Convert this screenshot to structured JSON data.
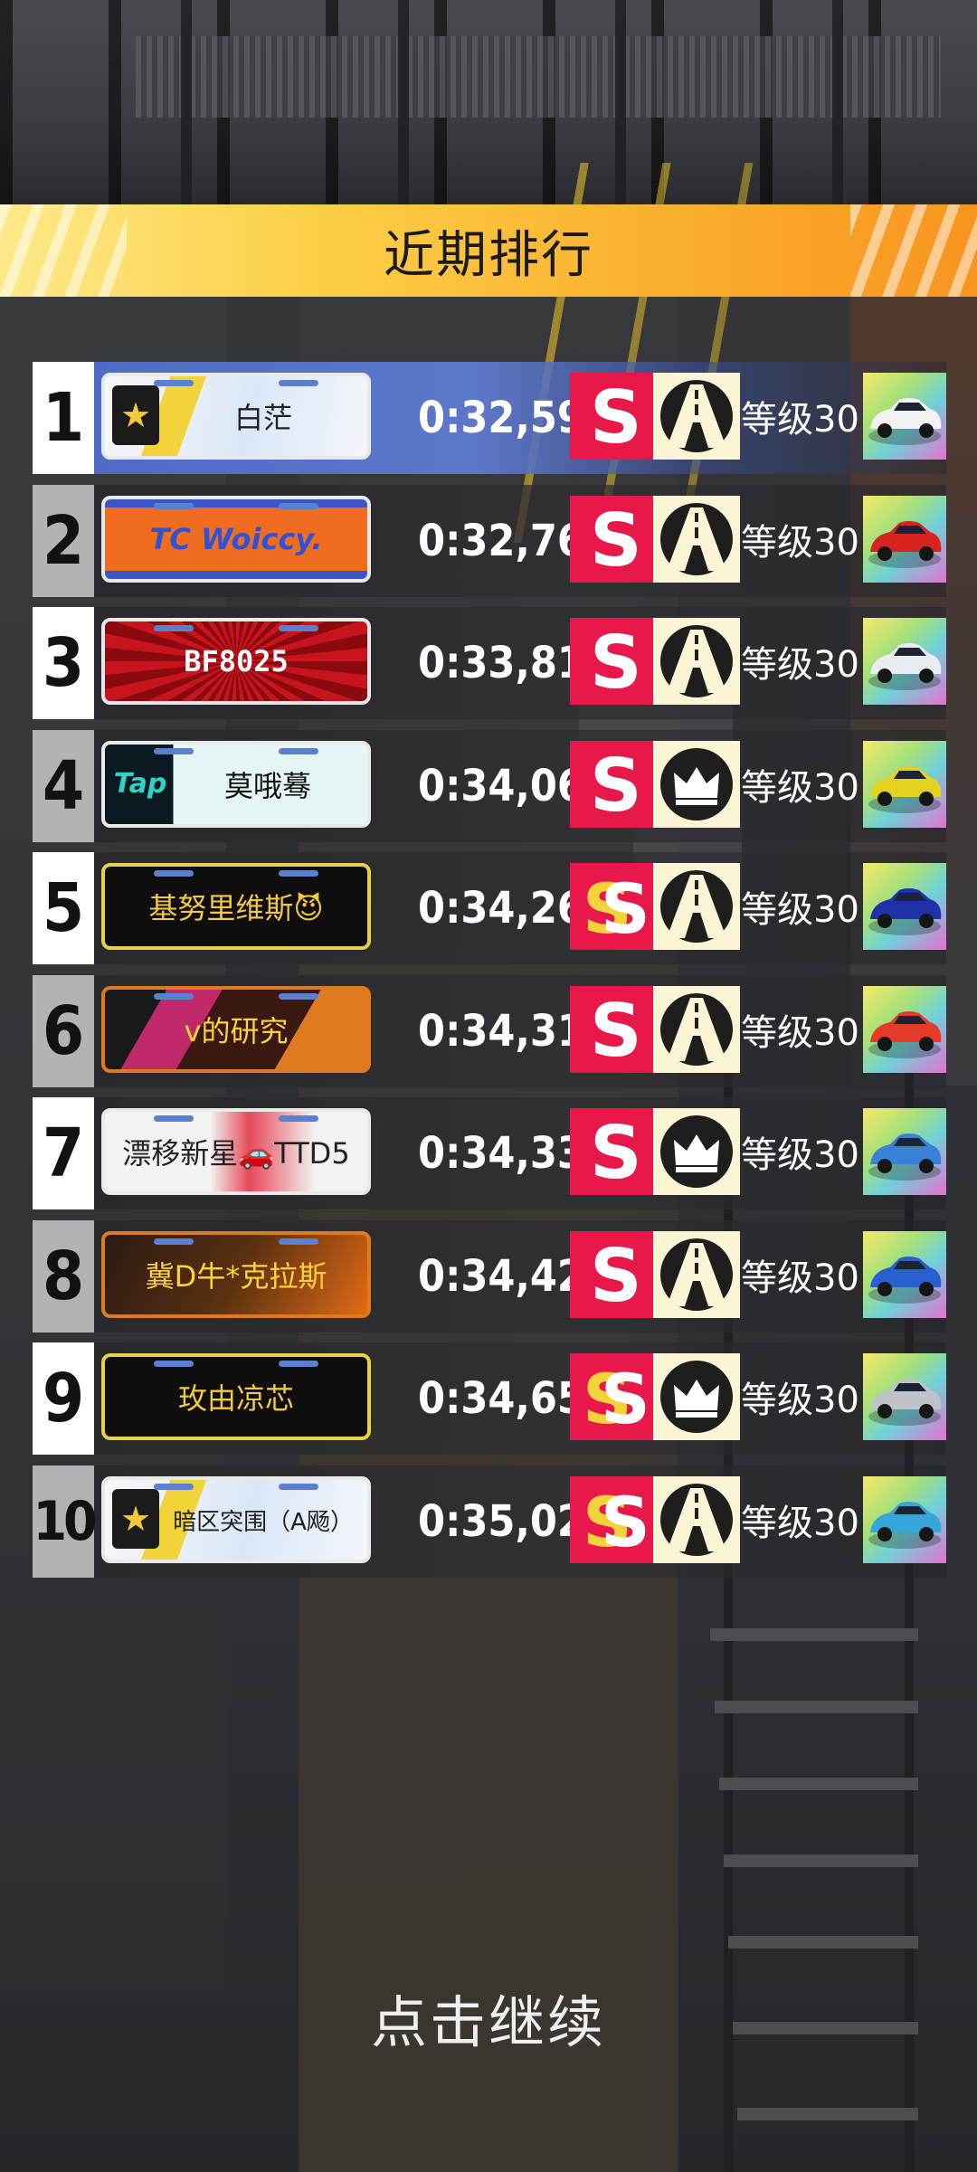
{
  "header": {
    "title": "近期排行"
  },
  "leaderboard": [
    {
      "rank": "1",
      "name": "白茫",
      "time": "0:32,59",
      "grade": "S",
      "track_icon": "road-icon",
      "level": "等级30",
      "car_color": "#f2f2f2",
      "plate_style": "white-blue"
    },
    {
      "rank": "2",
      "name": "TC Woiccy.",
      "time": "0:32,76",
      "grade": "S",
      "track_icon": "road-icon",
      "level": "等级30",
      "car_color": "#d8231f",
      "plate_style": "blue-orange"
    },
    {
      "rank": "3",
      "name": "BF8025",
      "time": "0:33,81",
      "grade": "S",
      "track_icon": "road-icon",
      "level": "等级30",
      "car_color": "#e9ecf2",
      "plate_style": "red-burst"
    },
    {
      "rank": "4",
      "name": "莫哦蓦",
      "time": "0:34,06",
      "grade": "S",
      "track_icon": "crown-icon",
      "level": "等级30",
      "car_color": "#e3d21f",
      "plate_style": "tap"
    },
    {
      "rank": "5",
      "name": "基努里维斯😈",
      "time": "0:34,26",
      "grade": "SS",
      "track_icon": "road-icon",
      "level": "等级30",
      "car_color": "#2032a8",
      "plate_style": "black-gold"
    },
    {
      "rank": "6",
      "name": "v的研究",
      "time": "0:34,31",
      "grade": "S",
      "track_icon": "road-icon",
      "level": "等级30",
      "car_color": "#e33a2a",
      "plate_style": "dark-neon"
    },
    {
      "rank": "7",
      "name": "漂移新星🚗TTD5",
      "time": "0:34,33",
      "grade": "S",
      "track_icon": "crown-icon",
      "level": "等级30",
      "car_color": "#3a7fd8",
      "plate_style": "white-red"
    },
    {
      "rank": "8",
      "name": "冀D牛*克拉斯",
      "time": "0:34,42",
      "grade": "S",
      "track_icon": "road-icon",
      "level": "等级30",
      "car_color": "#2a5fd0",
      "plate_style": "dark-orange"
    },
    {
      "rank": "9",
      "name": "玫由凉芯",
      "time": "0:34,65",
      "grade": "SS",
      "track_icon": "crown-icon",
      "level": "等级30",
      "car_color": "#bfc2c8",
      "plate_style": "black-gold"
    },
    {
      "rank": "10",
      "name": "暗区突围（A飏）",
      "time": "0:35,02",
      "grade": "SS",
      "track_icon": "road-icon",
      "level": "等级30",
      "car_color": "#36a7d8",
      "plate_style": "white-blue"
    }
  ],
  "footer": {
    "continue_label": "点击继续"
  }
}
